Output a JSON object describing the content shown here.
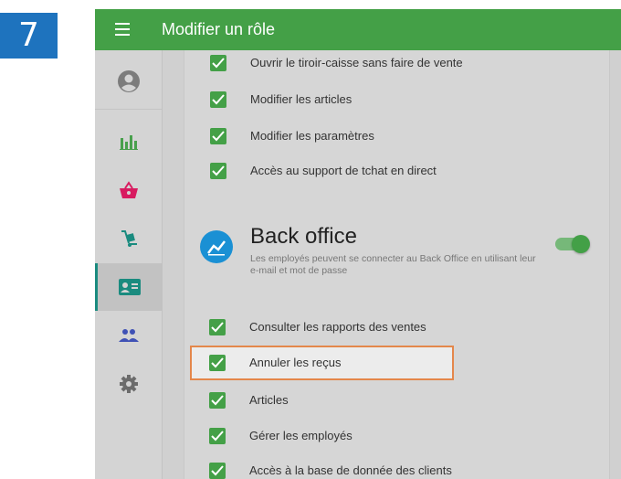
{
  "step": {
    "number": "7"
  },
  "header": {
    "title": "Modifier un rôle",
    "color": "#44a047"
  },
  "sidebar": {
    "items": [
      {
        "icon": "account-circle-icon"
      },
      {
        "icon": "bar-chart-icon"
      },
      {
        "icon": "basket-icon"
      },
      {
        "icon": "hand-truck-icon"
      },
      {
        "icon": "id-card-icon",
        "active": true
      },
      {
        "icon": "people-icon"
      },
      {
        "icon": "gear-icon"
      }
    ]
  },
  "pos_permissions": [
    {
      "label": "Ouvrir le tiroir-caisse sans faire de vente",
      "checked": true
    },
    {
      "label": "Modifier les articles",
      "checked": true
    },
    {
      "label": "Modifier les paramètres",
      "checked": true
    },
    {
      "label": "Accès au support de tchat en direct",
      "checked": true
    }
  ],
  "back_office": {
    "title": "Back office",
    "description": "Les employés peuvent se connecter au Back Office en utilisant leur e-mail et mot de passe",
    "enabled": true,
    "icon": "line-chart-icon"
  },
  "bo_permissions": [
    {
      "label": "Consulter les rapports des ventes",
      "checked": true
    },
    {
      "label": "Annuler les reçus",
      "checked": true,
      "highlighted": true
    },
    {
      "label": "Articles",
      "checked": true
    },
    {
      "label": "Gérer les employés",
      "checked": true
    },
    {
      "label": "Accès à la base de donnée des clients",
      "checked": true
    }
  ],
  "colors": {
    "accent_green": "#44a047",
    "highlight_border": "#e4874b",
    "step_badge": "#1e73be"
  }
}
